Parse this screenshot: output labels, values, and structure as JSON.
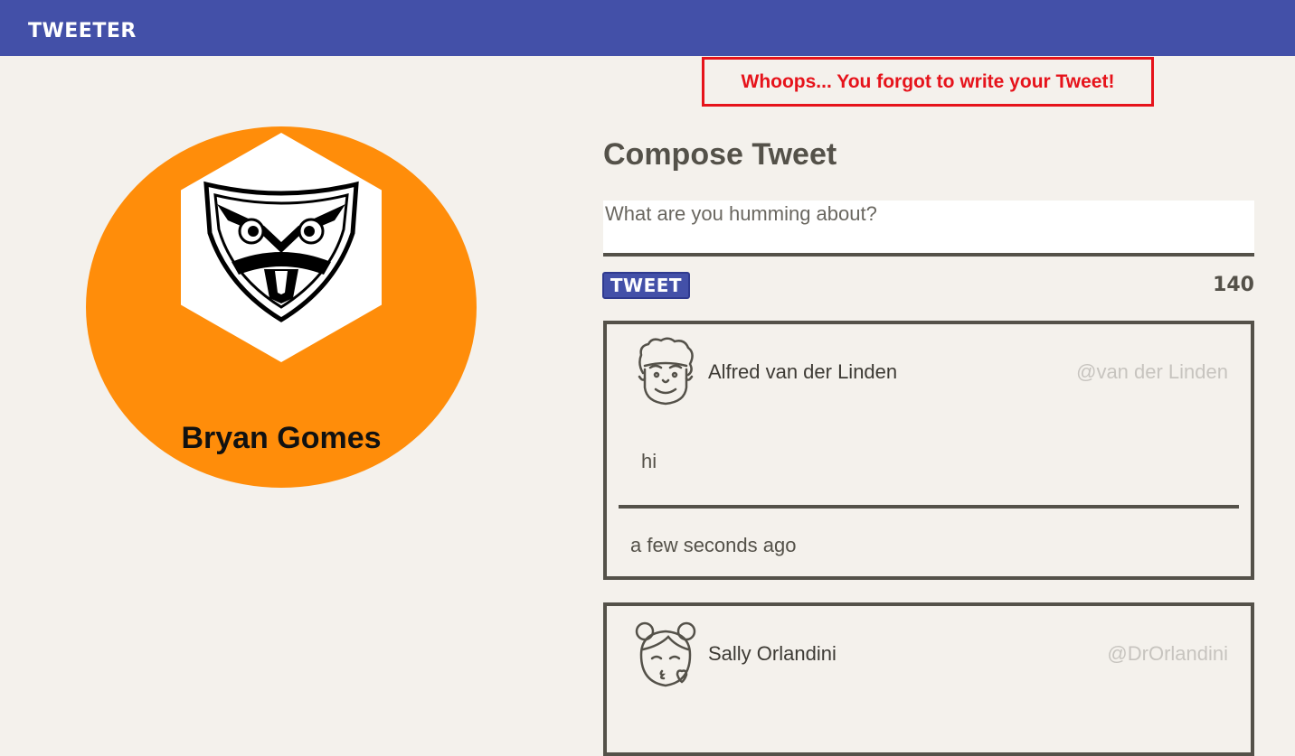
{
  "header": {
    "brand": "TWEETER",
    "bar_color": "#4350a8"
  },
  "alert": {
    "message": "Whoops... You forgot to write your Tweet!",
    "color": "#e6131b"
  },
  "profile": {
    "name": "Bryan Gomes",
    "circle_color": "#ff8d0a",
    "logo_icon": "owl-shield-icon"
  },
  "compose": {
    "title": "Compose Tweet",
    "placeholder": "What are you humming about?",
    "button_label": "TWEET",
    "counter": "140"
  },
  "tweets": [
    {
      "avatar_icon": "curly-hair-man-avatar-icon",
      "name": "Alfred van der Linden",
      "handle": "@van der Linden",
      "text": "hi",
      "time": "a few seconds ago"
    },
    {
      "avatar_icon": "woman-blowing-kiss-avatar-icon",
      "name": "Sally Orlandini",
      "handle": "@DrOrlandini"
    }
  ]
}
